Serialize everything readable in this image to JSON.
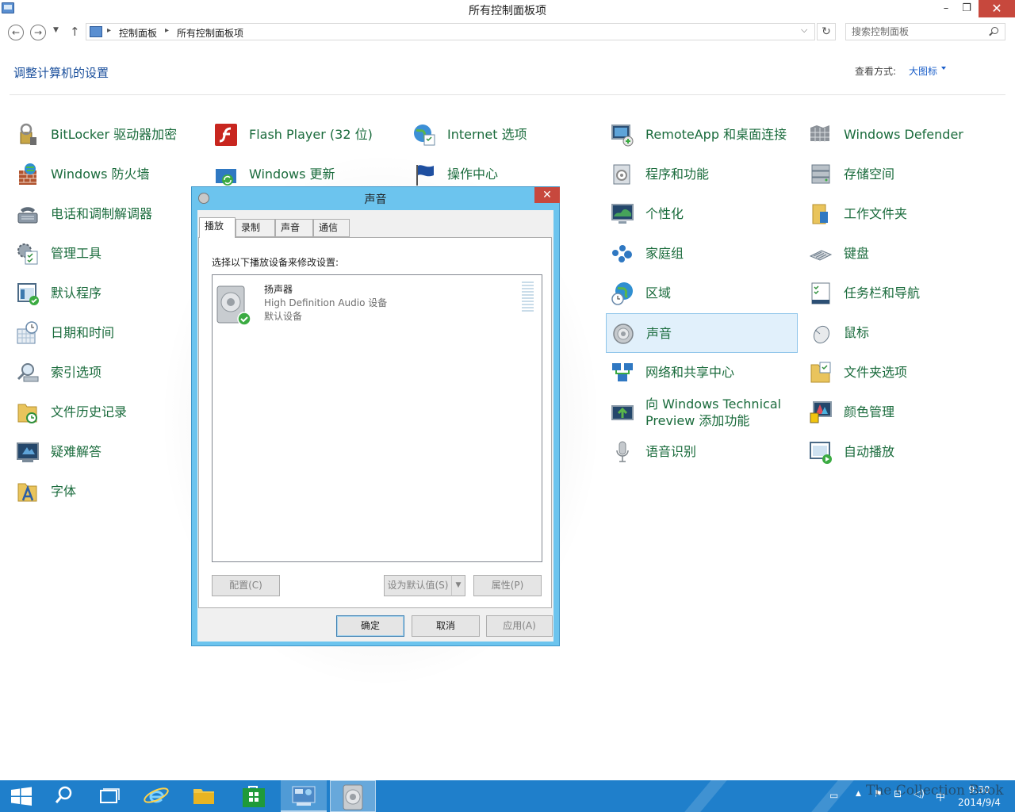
{
  "window": {
    "title": "所有控制面板项",
    "controls": {
      "minimize": "–",
      "maximize": "❐",
      "close": "✕"
    }
  },
  "address": {
    "breadcrumbs": [
      "控制面板",
      "所有控制面板项"
    ],
    "search_placeholder": "搜索控制面板"
  },
  "header": {
    "title": "调整计算机的设置",
    "view_label": "查看方式:",
    "view_value": "大图标"
  },
  "items": [
    {
      "label": "BitLocker 驱动器加密",
      "icon": "bitlocker-icon"
    },
    {
      "label": "Windows 防火墙",
      "icon": "firewall-icon"
    },
    {
      "label": "电话和调制解调器",
      "icon": "phone-modem-icon"
    },
    {
      "label": "管理工具",
      "icon": "admin-tools-icon"
    },
    {
      "label": "默认程序",
      "icon": "default-programs-icon"
    },
    {
      "label": "日期和时间",
      "icon": "date-time-icon"
    },
    {
      "label": "索引选项",
      "icon": "indexing-icon"
    },
    {
      "label": "文件历史记录",
      "icon": "file-history-icon"
    },
    {
      "label": "疑难解答",
      "icon": "troubleshooting-icon"
    },
    {
      "label": "字体",
      "icon": "fonts-icon"
    },
    {
      "label": "Flash Player (32 位)",
      "icon": "flash-icon"
    },
    {
      "label": "Windows 更新",
      "icon": "windows-update-icon"
    },
    {
      "label": "Internet 选项",
      "icon": "internet-options-icon"
    },
    {
      "label": "操作中心",
      "icon": "action-center-icon"
    },
    {
      "label": "RemoteApp 和桌面连接",
      "icon": "remoteapp-icon"
    },
    {
      "label": "程序和功能",
      "icon": "programs-features-icon"
    },
    {
      "label": "个性化",
      "icon": "personalization-icon"
    },
    {
      "label": "家庭组",
      "icon": "homegroup-icon"
    },
    {
      "label": "区域",
      "icon": "region-icon"
    },
    {
      "label": "声音",
      "icon": "sound-icon"
    },
    {
      "label": "网络和共享中心",
      "icon": "network-center-icon"
    },
    {
      "label": "向 Windows Technical Preview 添加功能",
      "icon": "add-features-icon"
    },
    {
      "label": "语音识别",
      "icon": "speech-icon"
    },
    {
      "label": "Windows Defender",
      "icon": "defender-icon"
    },
    {
      "label": "存储空间",
      "icon": "storage-spaces-icon"
    },
    {
      "label": "工作文件夹",
      "icon": "work-folders-icon"
    },
    {
      "label": "键盘",
      "icon": "keyboard-icon"
    },
    {
      "label": "任务栏和导航",
      "icon": "taskbar-nav-icon"
    },
    {
      "label": "鼠标",
      "icon": "mouse-icon"
    },
    {
      "label": "文件夹选项",
      "icon": "folder-options-icon"
    },
    {
      "label": "颜色管理",
      "icon": "color-management-icon"
    },
    {
      "label": "自动播放",
      "icon": "autoplay-icon"
    }
  ],
  "selected_item": "声音",
  "dialog": {
    "title": "声音",
    "close": "✕",
    "tabs": [
      "播放",
      "录制",
      "声音",
      "通信"
    ],
    "active_tab": "播放",
    "instruction": "选择以下播放设备来修改设置:",
    "device": {
      "name": "扬声器",
      "description": "High Definition Audio 设备",
      "status": "默认设备"
    },
    "buttons": {
      "configure": "配置(C)",
      "set_default": "设为默认值(S)",
      "properties": "属性(P)",
      "ok": "确定",
      "cancel": "取消",
      "apply": "应用(A)"
    }
  },
  "taskbar": {
    "clock_time": "9:30",
    "clock_date": "2014/9/4",
    "ime": "中",
    "watermark": "The Collection Book"
  },
  "colors": {
    "accent_blue": "#1a4f9c",
    "item_green": "#1a6b3c",
    "dialog_frame": "#6cc4ee",
    "taskbar": "#1f7fcb",
    "close_red": "#c7483d"
  }
}
